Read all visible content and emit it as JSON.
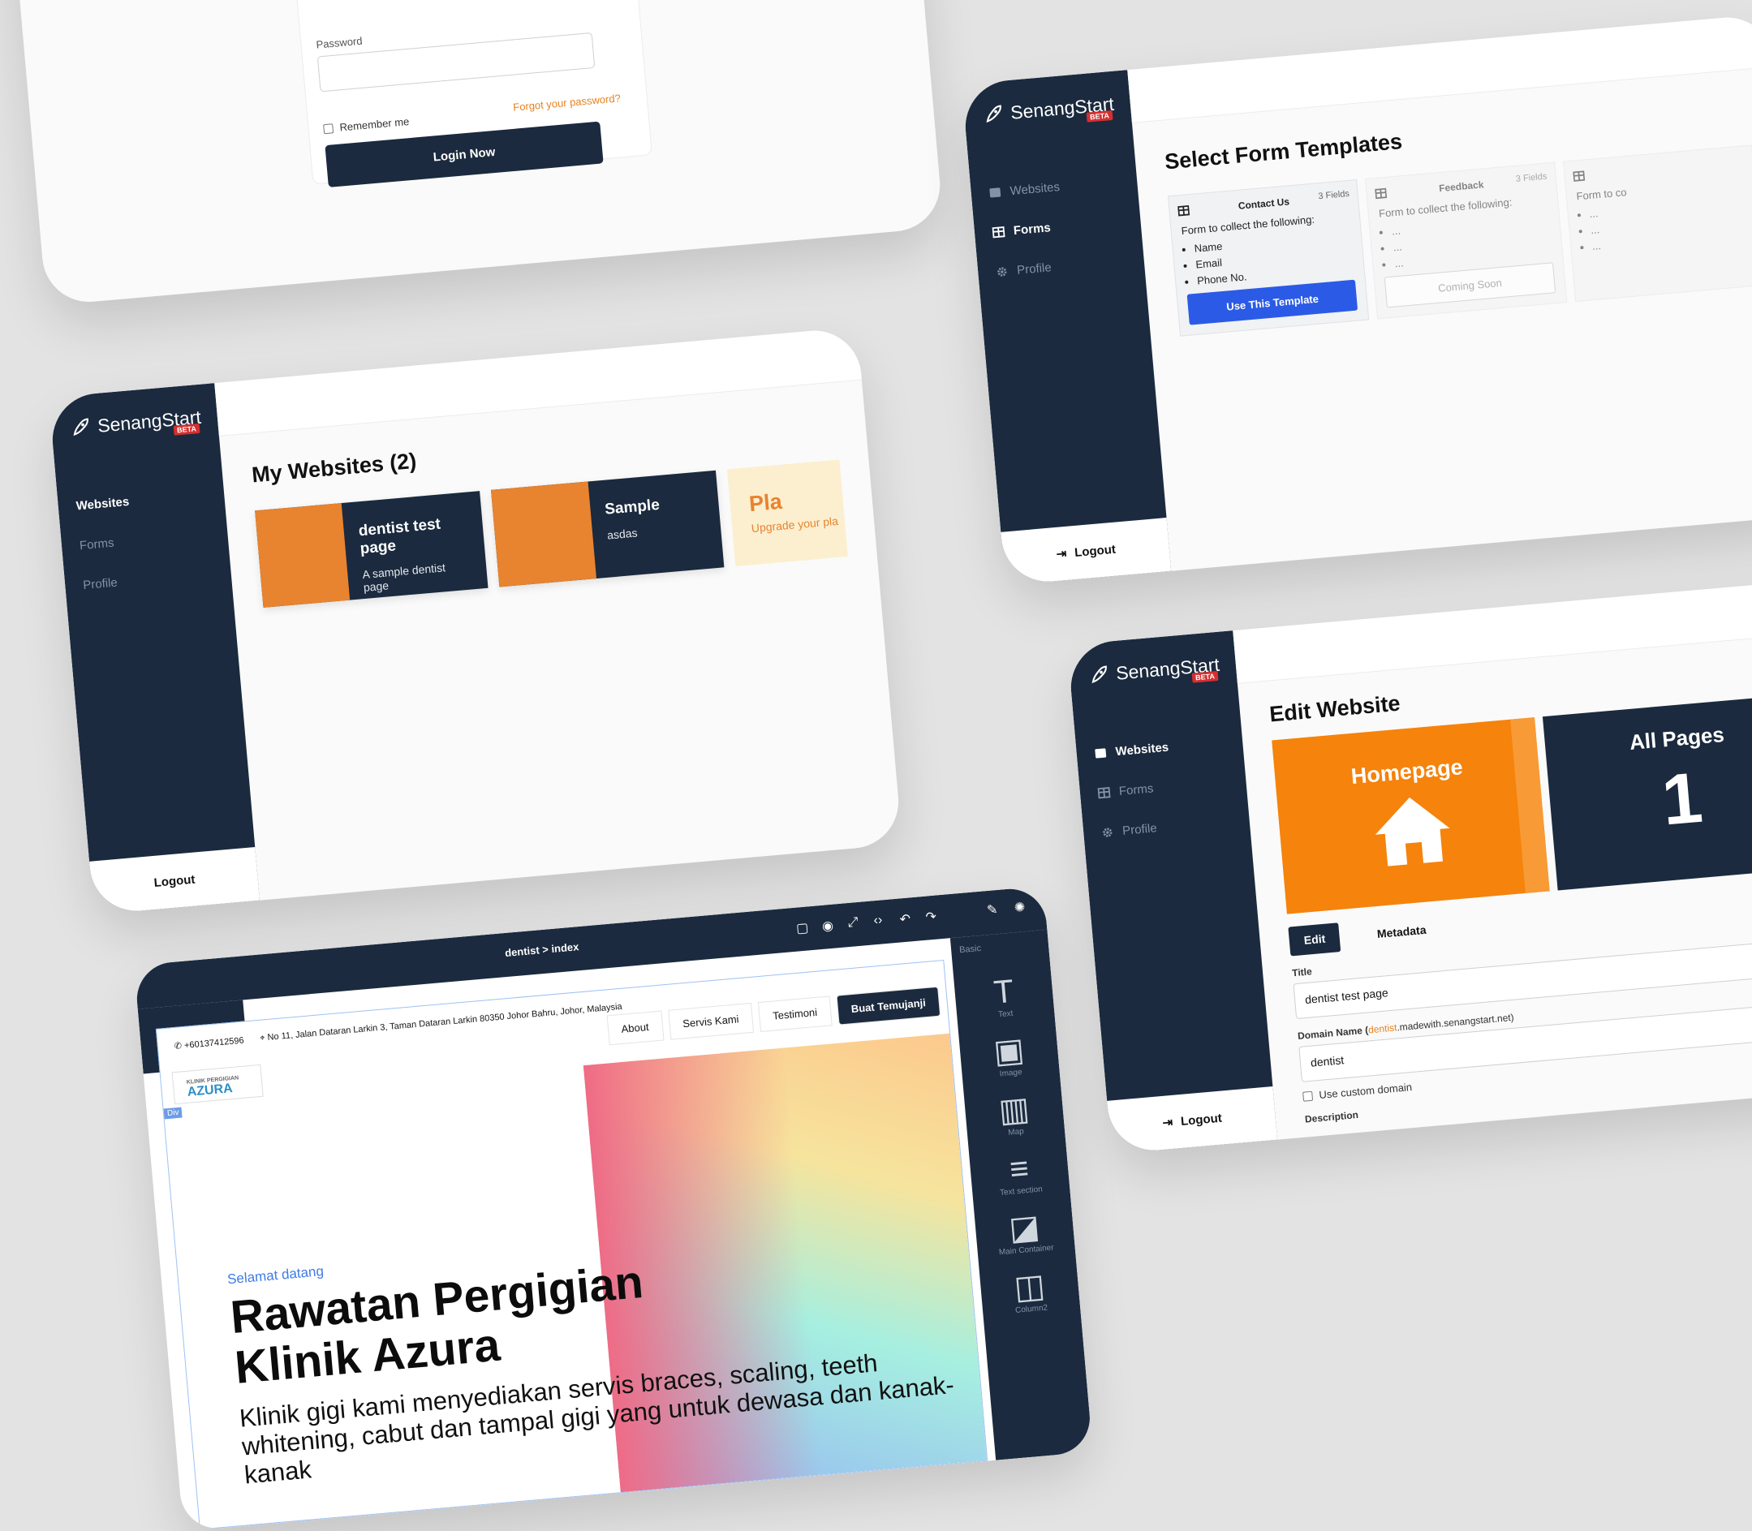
{
  "brand": {
    "name": "SenangStart",
    "badge": "BETA"
  },
  "nav": {
    "websites": "Websites",
    "forms": "Forms",
    "profile": "Profile",
    "logout": "Logout"
  },
  "login": {
    "password_label": "Password",
    "remember": "Remember me",
    "forgot": "Forgot your password?",
    "button": "Login Now"
  },
  "sites": {
    "title": "My Websites (2)",
    "items": [
      {
        "name": "dentist test page",
        "desc": "A sample dentist page"
      },
      {
        "name": "Sample",
        "desc": "asdas"
      }
    ],
    "plan_title": "Pla",
    "plan_text": "Upgrade your pla"
  },
  "forms": {
    "title": "Select Form Templates",
    "templates": [
      {
        "name": "Contact Us",
        "count": "3 Fields",
        "intro": "Form to collect the following:",
        "fields": [
          "Name",
          "Email",
          "Phone No."
        ],
        "button": "Use This Template"
      },
      {
        "name": "Feedback",
        "count": "3 Fields",
        "intro": "Form to collect the following:",
        "fields": [
          "...",
          "...",
          "..."
        ],
        "button": "Coming Soon"
      },
      {
        "name": "",
        "count": "",
        "intro": "Form to co",
        "fields": [
          "...",
          "...",
          "..."
        ],
        "button": ""
      }
    ]
  },
  "edit": {
    "title": "Edit Website",
    "homepage": "Homepage",
    "all_pages": "All Pages",
    "page_count": "1",
    "tab_edit": "Edit",
    "tab_metadata": "Metadata",
    "title_label": "Title",
    "title_value": "dentist test page",
    "domain_label": "Domain Name (",
    "domain_hl": "dentist",
    "domain_suffix": ".madewith.senangstart.net)",
    "domain_value": "dentist",
    "custom_domain": "Use custom domain",
    "description_label": "Description"
  },
  "editor": {
    "crumb_site": "dentist",
    "crumb_sep": ">",
    "crumb_page": "index",
    "panel_section": "Basic",
    "blocks": [
      {
        "glyph": "T",
        "label": "Text"
      },
      {
        "glyph": "▣",
        "label": "Image"
      },
      {
        "glyph": "▥",
        "label": "Map"
      },
      {
        "glyph": "≡",
        "label": "Text section"
      },
      {
        "glyph": "◪",
        "label": "Main Container"
      },
      {
        "glyph": "◫",
        "label": "Column2"
      }
    ],
    "div_tag": "Div",
    "site": {
      "phone": "+60137412596",
      "address": "No 11, Jalan Dataran Larkin 3, Taman Dataran Larkin 80350 Johor Bahru, Johor, Malaysia",
      "nav": [
        "About",
        "Servis Kami",
        "Testimoni"
      ],
      "cta": "Buat Temujanji",
      "logo_line1": "KLINIK PERGIGIAN",
      "logo_line2": "AZURA",
      "welcome": "Selamat datang",
      "headline_1": "Rawatan Pergigian",
      "headline_2": "Klinik Azura",
      "body": "Klinik gigi kami menyediakan servis braces, scaling, teeth whitening, cabut dan tampal gigi yang untuk dewasa dan kanak-kanak"
    }
  },
  "colors": {
    "navy": "#1b2a3e",
    "orange": "#e8832f",
    "blue": "#2b5be6",
    "cream": "#fcefcf"
  }
}
